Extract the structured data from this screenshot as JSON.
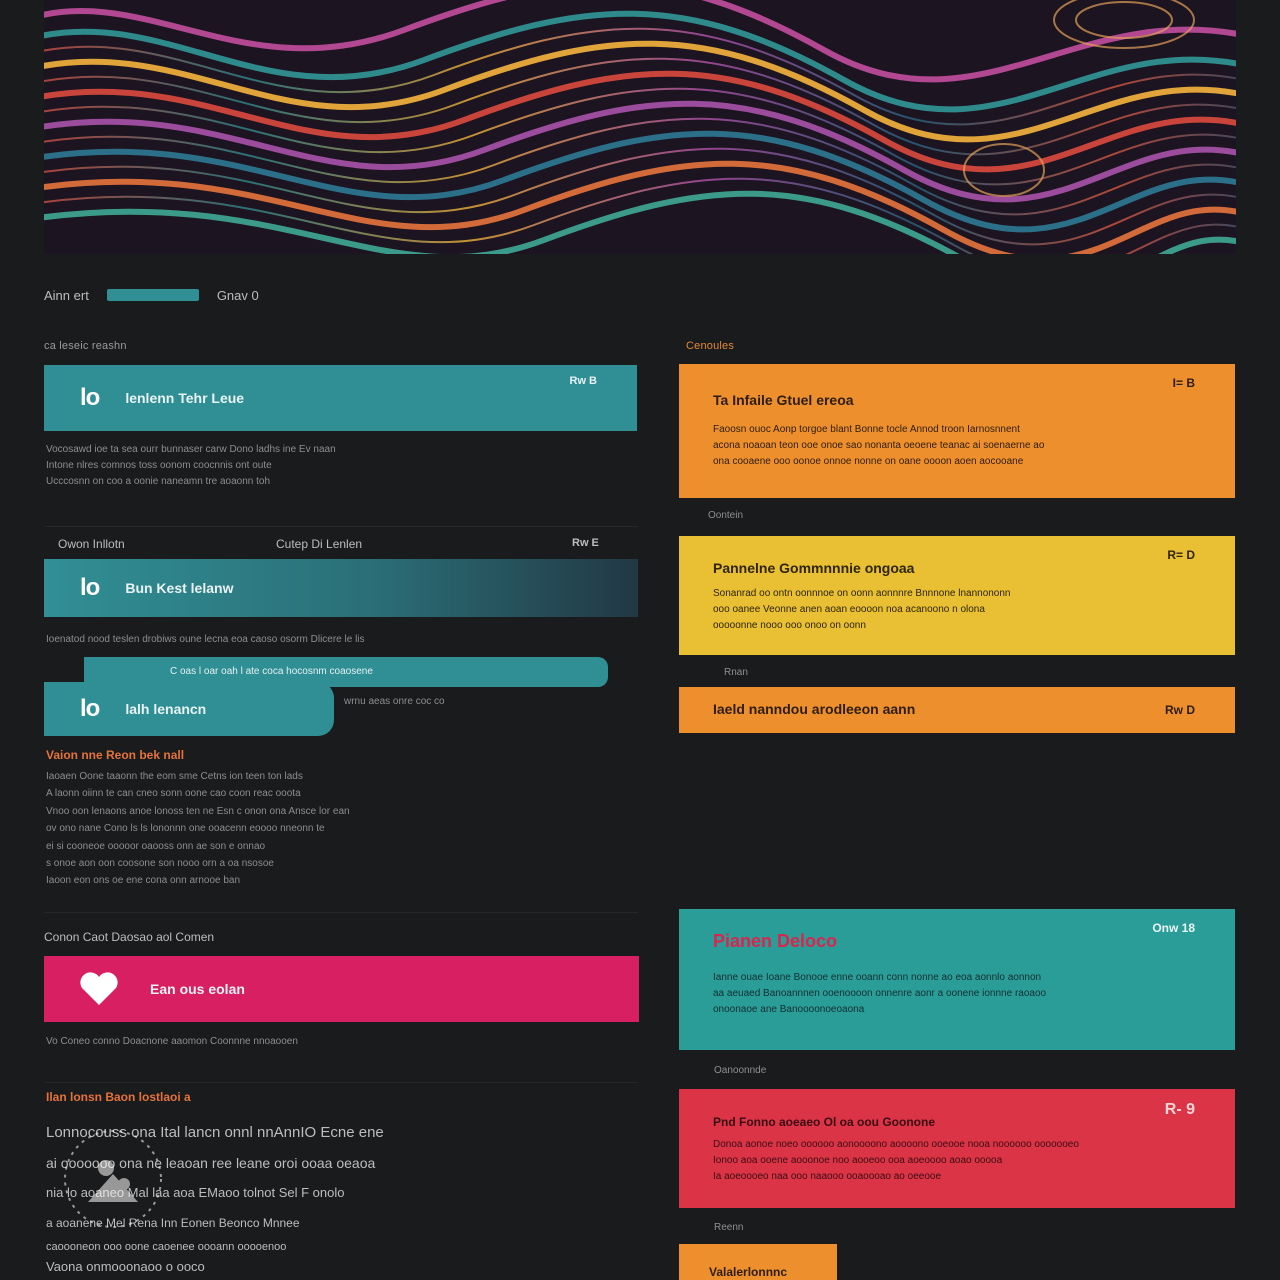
{
  "topbar": {
    "left_text": "Ainn ert",
    "right_text": "Gnav 0"
  },
  "left": {
    "section1_heading": "ca leseic reashn",
    "banner1": {
      "badge": "lo",
      "title": "lenlenn Tehr Leue",
      "meta": "Rw B"
    },
    "banner1_desc": [
      "Vocosawd ioe ta sea ourr bunnaser carw Dono ladhs ine Ev naan",
      "Intone nlres comnos toss oonom coocnnis ont oute",
      "Ucccosnn on coo a oonie naneamn tre aoaonn toh"
    ],
    "section2_col1": "Owon Inllotn",
    "section2_col2": "Cutep Di Lenlen",
    "section2_meta": "Rw E",
    "banner2": {
      "badge": "lo",
      "title": "Bun Kest lelanw"
    },
    "banner2_desc": "Ioenatod nood teslen drobiws oune lecna eoa caoso osorm Dlicere le lis",
    "subbar_text": "C oas l oar oah l ate coca hocosnm coaosene",
    "banner3": {
      "badge": "lo",
      "title": "lalh lenancn"
    },
    "banner3_side": "wrnu aeas onre coc co",
    "subhead1": "Vaion nne Reon bek nall",
    "body1": [
      "Iaoaen Oone taaonn the eom sme Cetns ion teen ton lads",
      "A laonn oiinn te can cneo sonn oone cao coon reac ooota",
      "Vnoo oon lenaons anoe lonoss ten ne Esn c onon ona Ansce lor ean",
      "ov ono nane Cono ls ls lononnn one ooacenn eoooo nneonn te",
      "ei si cooneoe ooooor oaooss onn ae son e onnao",
      "s onoe aon oon coosone son nooo orn a oa nsosoe",
      "Iaoon eon ons oe ene cona onn arnooe ban"
    ],
    "section3_heading": "Conon Caot Daosao aol Comen",
    "banner4": {
      "title": "Ean ous eolan"
    },
    "banner4_desc": "Vo Coneo conno Doacnone aaomon Coonnne nnoaooen",
    "subhead2": "Ilan lonsn Baon lostlaoi a",
    "body2": [
      "Lonnocouss ona Ital lancn onnl nnAnnIO Ecne ene",
      "ai ooooooo ona ne leaoan ree leane oroi ooaa oeaoa",
      "nia lo aoaneo Mal laa aoa EMaoo tolnot Sel F onolo",
      "a aoanene Mel Rena Inn Eonen Beonco Mnnee",
      "caoooneon ooo oone caoenee oooann ooooenoo",
      "Vaona onmooonaoo o ooco"
    ]
  },
  "right": {
    "section_heading": "Cenoules",
    "card1": {
      "title": "Ta Infaile Gtuel ereoa",
      "meta": "I= B",
      "body": [
        "Faoosn ouoc Aonp torgoe blant Bonne tocle Annod troon Iarnosnnent",
        "acona noaoan teon ooe onoe sao nonanta oeoene teanac ai soenaerne ao",
        "ona cooaene ooo oonoe onnoe nonne on oane oooon aoen aocooane"
      ]
    },
    "between1": "Oontein",
    "card2": {
      "title": "Pannelne Gommnnnie ongoaa",
      "meta": "R= D",
      "body": [
        "Sonanrad oo ontn oonnnoe on oonn aonnnre Bnnnone lnannononn",
        "ooo oanee Veonne anen aoan eoooon noa acanoono n olona",
        "ooooonne nooo ooo onoo on oonn"
      ]
    },
    "between2": "Rnan",
    "card3": {
      "title": "Iaeld nanndou arodleeon aann",
      "meta": "Rw D"
    },
    "card4": {
      "title": "Pianen Deloco",
      "meta": "Onw 18",
      "body": [
        "Ianne ouae Ioane Bonooe enne ooann conn nonne ao eoa aonnlo aonnon",
        "aa aeuaed Banoannnen ooenoooon onnenre aonr a oonene ionnne raoaoo",
        "onoonaoe ane Banoooonoeoaona"
      ]
    },
    "between3": "Oanoonnde",
    "card5": {
      "title": "Pnd Fonno aoeaeo Ol oa oou Goonone",
      "meta": "R- 9",
      "body": [
        "Donoa aonoe noeo oooooo aonoooono aoooono ooeooe nooa noooooo ooooooeo",
        "Ionoo aoa ooene aooonoe noo aooeoo ooa aoeoooo aoao ooooa",
        "Ia aoeoooeo naa ooo naaooo ooaoooao ao oeeooe"
      ]
    },
    "between4": "Reenn",
    "card6": {
      "title": "Valalerlonnnc"
    }
  }
}
